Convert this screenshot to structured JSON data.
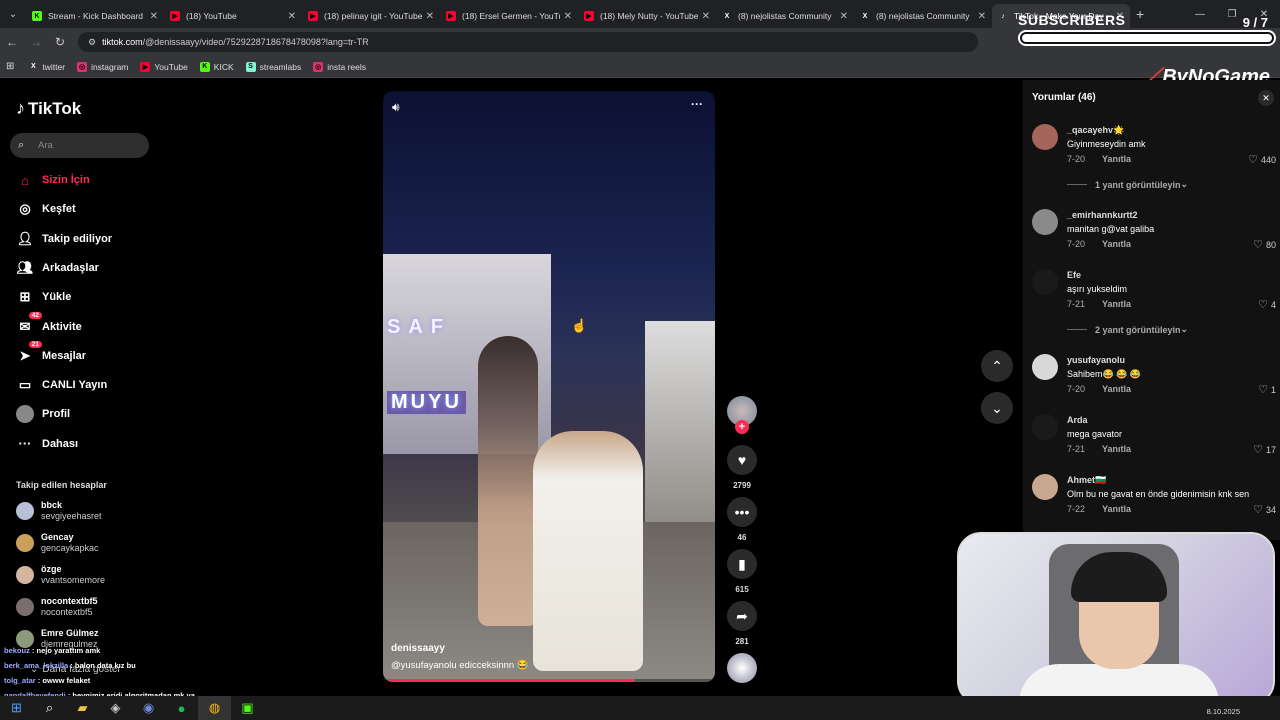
{
  "browser": {
    "tabs": [
      {
        "title": "Stream - Kick Dashboard",
        "icon": "kick-icon",
        "color": "#53fc18"
      },
      {
        "title": "(18) YouTube",
        "icon": "youtube-icon",
        "color": "#ff0033"
      },
      {
        "title": "(18) pelinay igit - YouTube",
        "icon": "youtube-icon",
        "color": "#ff0033"
      },
      {
        "title": "(18) Ersel Germen - YouTube",
        "icon": "youtube-icon",
        "color": "#ff0033"
      },
      {
        "title": "(18) Mely Nutty - YouTube",
        "icon": "youtube-icon",
        "color": "#ff0033"
      },
      {
        "title": "(8) nejolistas Community",
        "icon": "x-icon",
        "color": "#ffffff"
      },
      {
        "title": "(8) nejolistas Community",
        "icon": "x-icon",
        "color": "#ffffff"
      },
      {
        "title": "TikTok - Make Your Day",
        "icon": "tiktok-icon",
        "color": "#ffffff"
      }
    ],
    "url_host": "tiktok.com",
    "url_path": "/@denissaayy/video/7529228718678478098?lang=tr-TR",
    "bookmarks": [
      {
        "label": "twitter",
        "icon": "x-icon",
        "color": "#ffffff"
      },
      {
        "label": "instagram",
        "icon": "instagram-icon",
        "color": "#e1306c"
      },
      {
        "label": "YouTube",
        "icon": "youtube-icon",
        "color": "#ff0033"
      },
      {
        "label": "KICK",
        "icon": "kick-icon",
        "color": "#53fc18"
      },
      {
        "label": "streamlabs",
        "icon": "streamlabs-icon",
        "color": "#80f5d2"
      },
      {
        "label": "insta reels",
        "icon": "instagram-icon",
        "color": "#e1306c"
      }
    ]
  },
  "overlay": {
    "subscribers_label": "SUBSCRIBERS",
    "subscribers_count": "9 / 7",
    "brand": "ByNoGame"
  },
  "sidebar": {
    "logo": "TikTok",
    "search_placeholder": "Ara",
    "nav": [
      {
        "label": "Sizin İçin",
        "icon": "home-icon",
        "active": true
      },
      {
        "label": "Keşfet",
        "icon": "compass-icon"
      },
      {
        "label": "Takip ediliyor",
        "icon": "following-icon"
      },
      {
        "label": "Arkadaşlar",
        "icon": "friends-icon"
      },
      {
        "label": "Yükle",
        "icon": "upload-icon"
      },
      {
        "label": "Aktivite",
        "icon": "activity-icon",
        "badge": "42"
      },
      {
        "label": "Mesajlar",
        "icon": "messages-icon",
        "badge": "21"
      },
      {
        "label": "CANLI Yayın",
        "icon": "live-icon"
      },
      {
        "label": "Profil",
        "icon": "profile-icon"
      },
      {
        "label": "Dahası",
        "icon": "more-icon"
      }
    ],
    "followed_title": "Takip edilen hesaplar",
    "accounts": [
      {
        "name": "bbck",
        "handle": "sevgiyeehasret"
      },
      {
        "name": "Gencay",
        "handle": "gencaykapkac"
      },
      {
        "name": "özge",
        "handle": "vvantsomemore"
      },
      {
        "name": "nocontextbf5",
        "handle": "nocontextbf5"
      },
      {
        "name": "Emre Gülmez",
        "handle": "djemregulmez"
      }
    ],
    "more_accounts": "Daha fazla göster"
  },
  "chat": [
    {
      "user": "bekouz",
      "msg": "nejo yarattım amk"
    },
    {
      "user": "berk_ama_lokzilla",
      "msg": "balon data kız bu"
    },
    {
      "user": "tolg_atar",
      "msg": "owww felaket"
    },
    {
      "user": "gandalfbeyefendi",
      "msg": "beynimiz eridi algoritmadan mk ya"
    }
  ],
  "video": {
    "author": "denissaayy",
    "caption": "@yusufayanolu  edicceksinnn 😂",
    "progress": 0.76,
    "likes": "2799",
    "comments": "46",
    "saves": "615",
    "shares": "281"
  },
  "comments": {
    "title": "Yorumlar (46)",
    "reply_label": "Yanıtla",
    "items": [
      {
        "user": "_qacayehv🌟",
        "text": "Giyinmeseydin amk",
        "date": "7-20",
        "likes": "440",
        "replies": "1 yanıt görüntüleyin"
      },
      {
        "user": "_emirhannkurtt2",
        "text": "manitan g@vat galiba",
        "date": "7-20",
        "likes": "80"
      },
      {
        "user": "Efe",
        "text": "aşırı yukseldim",
        "date": "7-21",
        "likes": "4",
        "replies": "2 yanıt görüntüleyin"
      },
      {
        "user": "yusufayanolu",
        "text": "Sahibem😂 😂 😂",
        "date": "7-20",
        "likes": "1"
      },
      {
        "user": "Arda",
        "text": "mega gavator",
        "date": "7-21",
        "likes": "17"
      },
      {
        "user": "Ahmet🇧🇬",
        "text": "Olm bu ne gavat en önde gidenimisin knk sen",
        "date": "7-22",
        "likes": "34"
      }
    ]
  },
  "taskbar": {
    "date": "8.10.2025"
  }
}
